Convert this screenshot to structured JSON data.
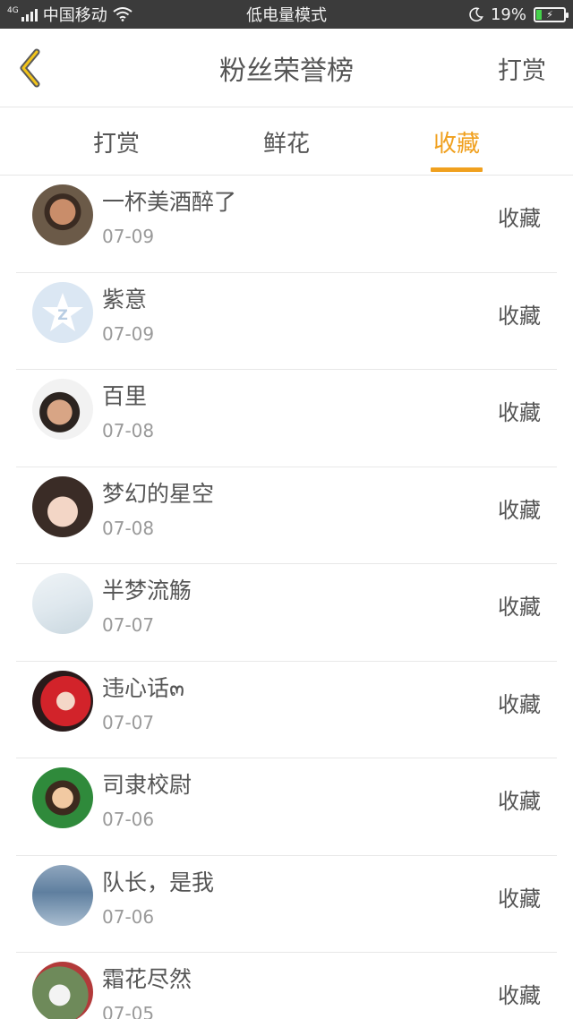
{
  "status_bar": {
    "network_type": "4G",
    "carrier": "中国移动",
    "mode": "低电量模式",
    "battery_percent": "19%",
    "battery_level": 0.19,
    "icons": [
      "signal-icon",
      "wifi-icon",
      "moon-icon",
      "battery-charging-icon"
    ]
  },
  "header": {
    "back_icon": "chevron-left-icon",
    "title": "粉丝荣誉榜",
    "action_label": "打赏",
    "accent_color": "#f0a01e"
  },
  "tabs": [
    {
      "label": "打赏",
      "active": false
    },
    {
      "label": "鲜花",
      "active": false
    },
    {
      "label": "收藏",
      "active": true
    }
  ],
  "list": [
    {
      "name": "一杯美酒醉了",
      "date": "07-09",
      "action": "收藏"
    },
    {
      "name": "紫意",
      "date": "07-09",
      "action": "收藏"
    },
    {
      "name": "百里",
      "date": "07-08",
      "action": "收藏"
    },
    {
      "name": "梦幻的星空",
      "date": "07-08",
      "action": "收藏"
    },
    {
      "name": "半梦流觞",
      "date": "07-07",
      "action": "收藏"
    },
    {
      "name": "违心话๓",
      "date": "07-07",
      "action": "收藏"
    },
    {
      "name": "司隶校尉",
      "date": "07-06",
      "action": "收藏"
    },
    {
      "name": "队长，是我",
      "date": "07-06",
      "action": "收藏"
    },
    {
      "name": "霜花尽然",
      "date": "07-05",
      "action": "收藏"
    }
  ]
}
